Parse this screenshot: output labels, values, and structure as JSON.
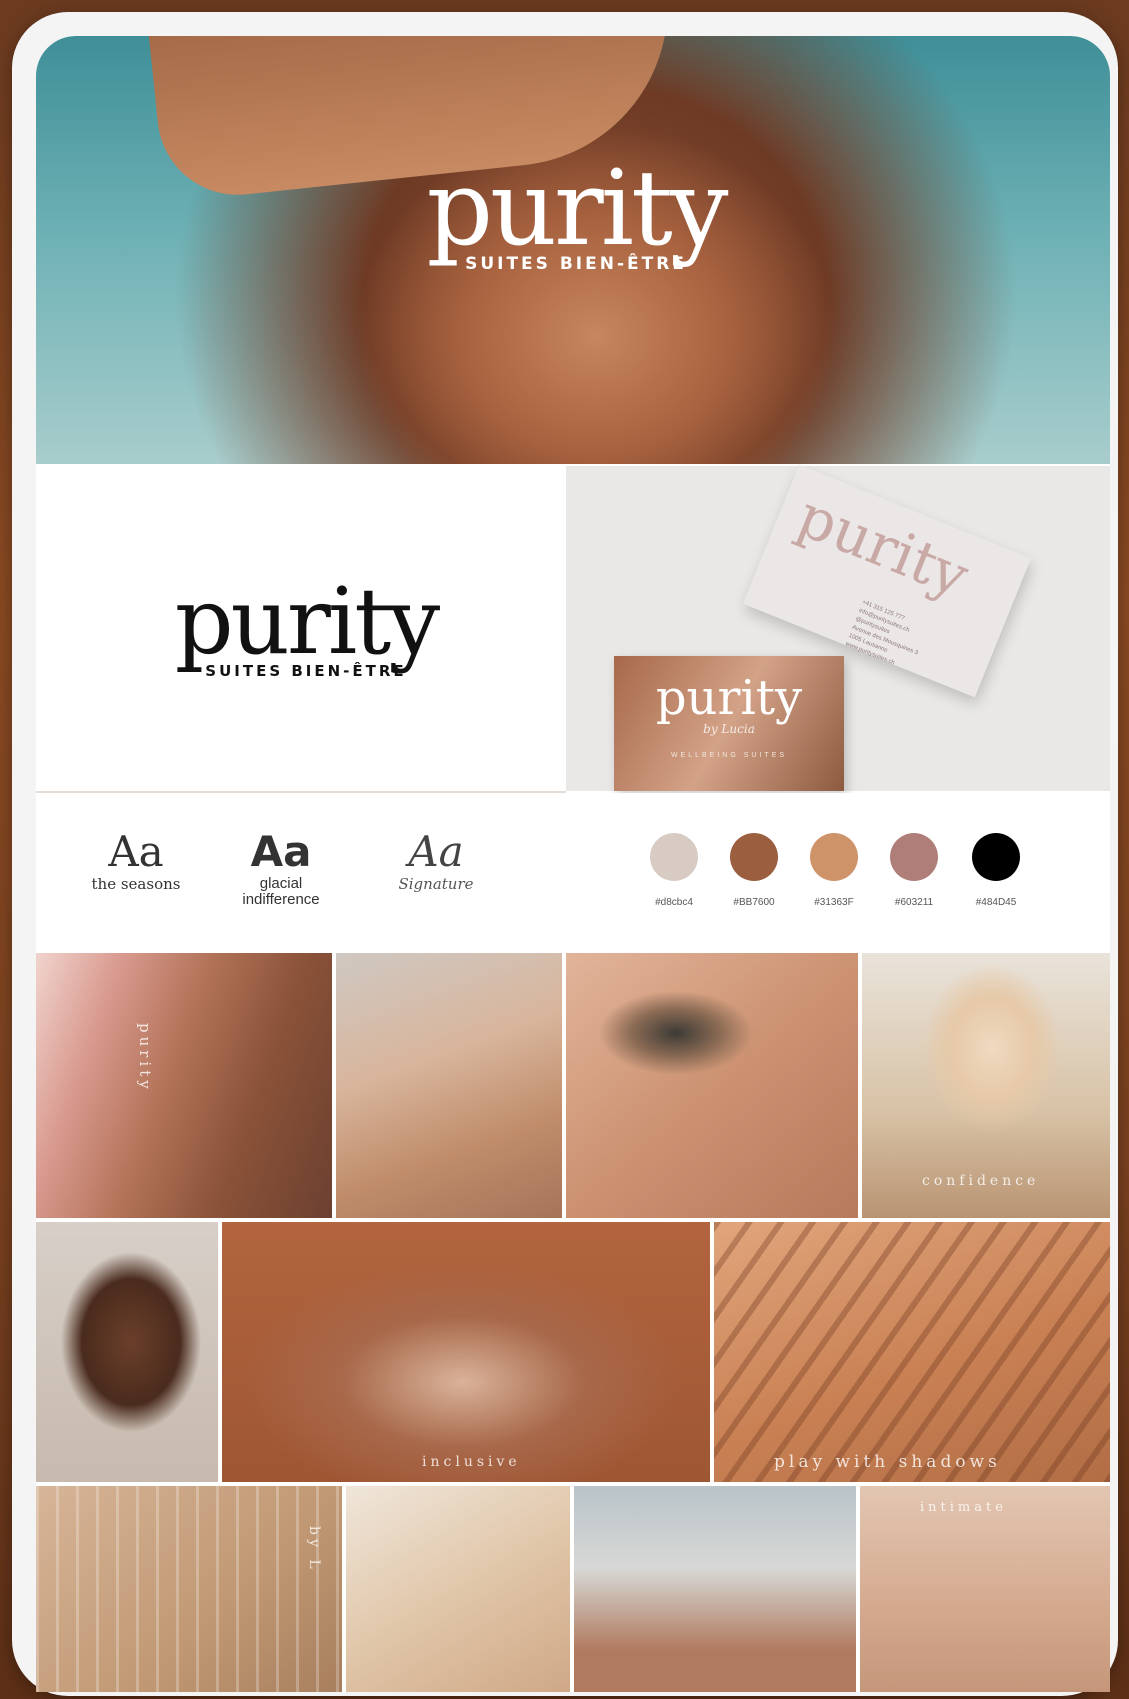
{
  "hero": {
    "logo_word": "purity",
    "logo_tagline": "SUITES BIEN-ÊTRE"
  },
  "brand_logo": {
    "word": "purity",
    "tagline": "SUITES BIEN-ÊTRE"
  },
  "mockup": {
    "business_card": {
      "logo": "purity",
      "contact": "+41 315 125 777\ninfo@puritysuites.ch\n@puritysuites\nAvenue des Mousquines 3\n1005 Lausanne\nwww.puritysuites.ch"
    },
    "photo_card": {
      "logo": "purity",
      "subtitle": "by Lucia",
      "tagline": "WELLBEING SUITES"
    }
  },
  "fonts": [
    {
      "sample": "Aa",
      "name": "the seasons"
    },
    {
      "sample": "Aa",
      "name": "glacial indifference"
    },
    {
      "sample": "Aa",
      "name": "Signature"
    }
  ],
  "palette": [
    {
      "color": "#d8cbc4",
      "label": "#d8cbc4"
    },
    {
      "color": "#9b5e3f",
      "label": "#BB7600"
    },
    {
      "color": "#cf936a",
      "label": "#31363F"
    },
    {
      "color": "#b07e79",
      "label": "#603211"
    },
    {
      "color": "#000000",
      "label": "#484D45"
    }
  ],
  "captions": {
    "lips": "purity",
    "confidence": "confidence",
    "inclusive": "inclusive",
    "shadows": "play with shadows",
    "by": "by L",
    "intimate": "intimate"
  }
}
